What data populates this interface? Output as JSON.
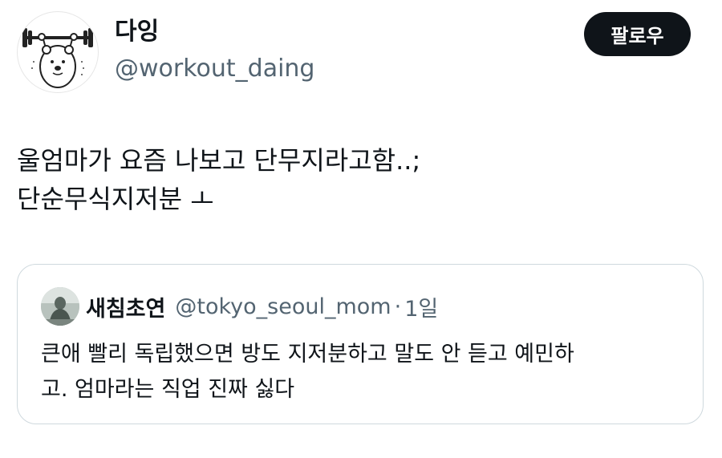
{
  "author": {
    "display_name": "다잉",
    "handle": "@workout_daing",
    "avatar_icon": "bear-lifting-barbell-icon"
  },
  "follow_button": {
    "label": "팔로우"
  },
  "tweet": {
    "lines": [
      "울엄마가 요즘 나보고 단무지라고함..;",
      "단순무식지저분 ㅗ"
    ]
  },
  "quote": {
    "display_name": "새침초연",
    "handle": "@tokyo_seoul_mom",
    "dot": "·",
    "time": "1일",
    "lines": [
      "큰애 빨리 독립했으면 방도 지저분하고 말도 안 듣고 예민하",
      "고. 엄마라는 직업 진짜 싫다"
    ],
    "avatar_icon": "statue-photo-icon"
  },
  "colors": {
    "text": "#0f1419",
    "secondary": "#536471",
    "border": "#cfd9de",
    "button_bg": "#0f1419"
  }
}
